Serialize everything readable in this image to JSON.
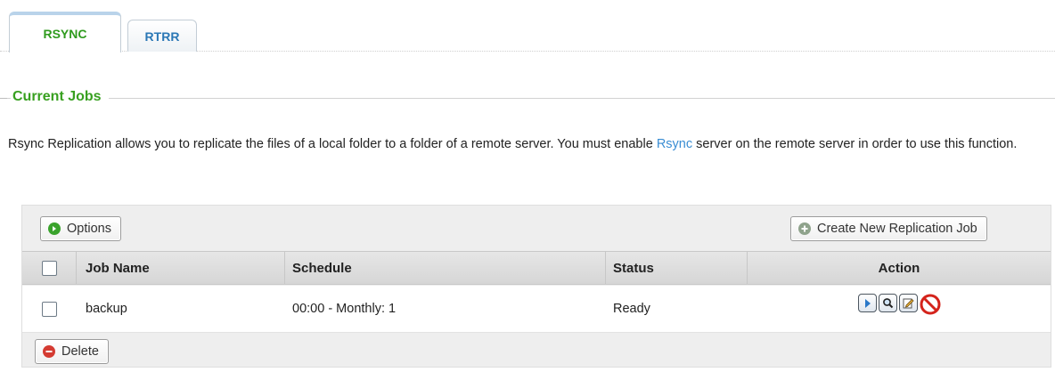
{
  "tabs": [
    {
      "label": "RSYNC",
      "active": true
    },
    {
      "label": "RTRR",
      "active": false
    }
  ],
  "section": {
    "title": "Current Jobs"
  },
  "description": {
    "before_link": "Rsync Replication allows you to replicate the files of a local folder to a folder of a remote server. You must enable ",
    "link": "Rsync",
    "after_link": " server on the remote server in order to use this function."
  },
  "toolbar": {
    "options_label": "Options",
    "create_label": "Create New Replication Job",
    "delete_label": "Delete"
  },
  "table": {
    "columns": [
      "",
      "Job Name",
      "Schedule",
      "Status",
      "Action"
    ],
    "rows": [
      {
        "checked": false,
        "job_name": "backup",
        "schedule": "00:00 - Monthly: 1",
        "status": "Ready",
        "actions": [
          "start-icon",
          "view-icon",
          "edit-icon",
          "stop-icon"
        ]
      }
    ]
  },
  "colors": {
    "accent_green": "#38a020",
    "link_blue": "#3a8dd3",
    "tab_blue": "#2b78b6"
  }
}
